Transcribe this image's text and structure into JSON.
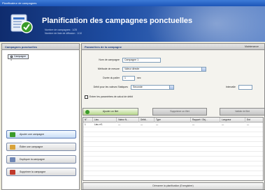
{
  "window": {
    "title": "Planificateur de campagnes"
  },
  "banner": {
    "title": "Planification des campagnes ponctuelles",
    "subtitle_1": "Nombre de campagnes : 1/25",
    "subtitle_2": "Nombre de liste de diffusion : 1/10"
  },
  "left_panel": {
    "header": "Campagnes ponctuelles",
    "items": [
      {
        "label": "Campagne 1"
      }
    ],
    "buttons": [
      {
        "label": "Ajouter une campagne",
        "icon": "add-icon"
      },
      {
        "label": "Éditer une campagne",
        "icon": "edit-icon"
      },
      {
        "label": "Dupliquer la campagne",
        "icon": "duplicate-icon"
      },
      {
        "label": "Supprimer la campagne",
        "icon": "delete-icon"
      }
    ]
  },
  "right_panel": {
    "header": "Paramètres de la campagne",
    "menu_label": "Maintenance",
    "form": {
      "name_label": "Nom de campagne",
      "name_value": "Campagne 1",
      "method_label": "Méthode de mesure",
      "method_value": "Valeur directe",
      "duration_label": "Durée du palier",
      "duration_value": "1",
      "duration_unit": "sec",
      "start_label": "Débit pour les valeurs Statiques",
      "start_value": "Seconde",
      "interval_label": "Intervalle",
      "interval_value": "",
      "checkbox_label": "Entrer les paramètres de calcul de débit"
    },
    "tabs": [
      {
        "label": "Ajouter un filet",
        "active": true
      },
      {
        "label": "Supprimer un filet",
        "active": false
      },
      {
        "label": "Valider le filet",
        "active": false
      }
    ],
    "table": {
      "columns": [
        "N°",
        "Lieu",
        "Valeur N...",
        "Débit...",
        "Type",
        "Rapport / Obj...",
        "Longueur",
        "Ent"
      ],
      "rows": [
        [
          "1",
          "Lieu nº1",
          "—",
          "—",
          "—",
          "—",
          "—",
          "—"
        ]
      ]
    },
    "footer_button": "Démarrer la planification (Enregistrer)"
  },
  "colors": {
    "banner_dark": "#0f2c6e",
    "banner_light": "#5b83c8",
    "tab_active": "#b6d68a",
    "accent_blue": "#1d3f82"
  }
}
